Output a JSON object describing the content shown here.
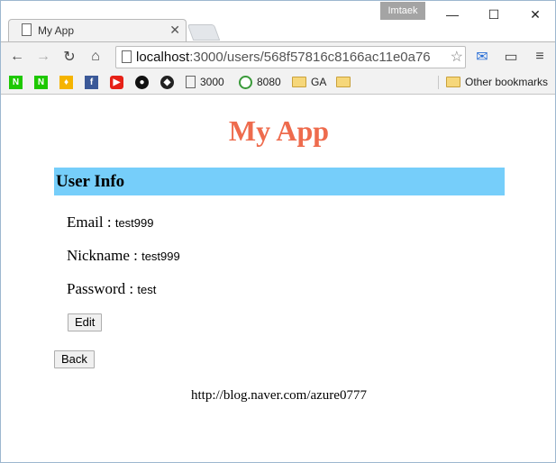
{
  "window": {
    "user_badge": "Imtaek"
  },
  "tab": {
    "title": "My App"
  },
  "toolbar": {
    "url_host": "localhost",
    "url_rest": ":3000/users/568f57816c8166ac11e0a76"
  },
  "bookmarks": {
    "items": [
      {
        "label": "3000"
      },
      {
        "label": "8080"
      },
      {
        "label": "GA"
      },
      {
        "label": ""
      }
    ],
    "other": "Other bookmarks"
  },
  "page": {
    "title": "My App",
    "section_header": "User Info",
    "fields": [
      {
        "label": "Email",
        "value": "test999"
      },
      {
        "label": "Nickname",
        "value": "test999"
      },
      {
        "label": "Password",
        "value": "test"
      }
    ],
    "edit_label": "Edit",
    "back_label": "Back",
    "footer_link": "http://blog.naver.com/azure0777"
  }
}
